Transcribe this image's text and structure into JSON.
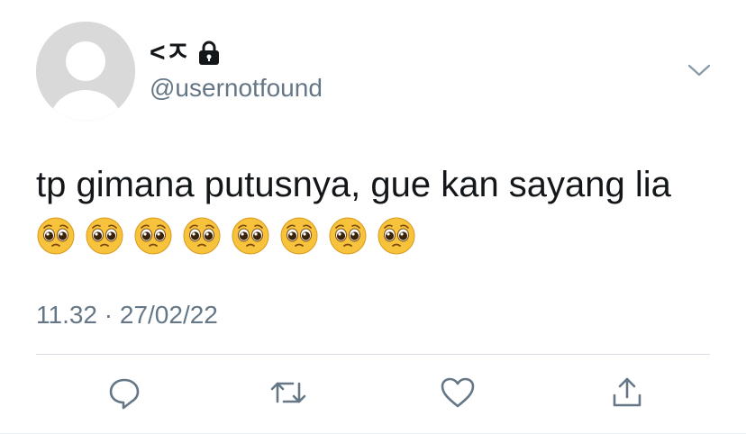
{
  "tweet": {
    "display_name": "<ㅈ",
    "handle": "@usernotfound",
    "text": "tp gimana putusnya, gue kan sayang lia",
    "emoji_count": 8,
    "emoji_name": "pleading-face",
    "timestamp": "11.32 · 27/02/22"
  },
  "icons": {
    "protected": "lock-icon",
    "more": "chevron-down-icon",
    "reply": "reply-icon",
    "retweet": "retweet-icon",
    "like": "heart-icon",
    "share": "share-icon"
  },
  "colors": {
    "text": "#14171a",
    "secondary": "#657786",
    "icon": "#657786",
    "avatar_bg": "#d9d9d9",
    "emoji_face": "#f7c23c"
  }
}
